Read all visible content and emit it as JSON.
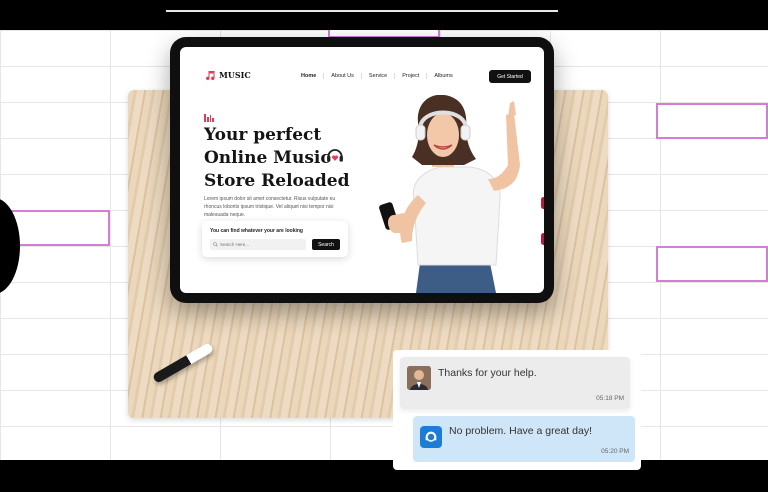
{
  "website": {
    "logo_text": "MUSIC",
    "nav": [
      "Home",
      "About Us",
      "Service",
      "Project",
      "Albums"
    ],
    "cta_label": "Get Started",
    "hero_title": "Your perfect Online Music Store Reloaded",
    "hero_description": "Lorem ipsum dolor sit amet consectetur. Risus vulputate eu rhoncus lobortis ipsum tristique. Vel aliquet nisi tempor nisi malesuada neque.",
    "search_label": "You can find whatever your are looking",
    "search_placeholder": "Search Here...",
    "search_button": "Search"
  },
  "chat": {
    "messages": [
      {
        "text": "Thanks for your help.",
        "time": "05:18 PM"
      },
      {
        "text": "No problem. Have a great day!",
        "time": "05:20 PM"
      }
    ]
  },
  "colors": {
    "accent": "#e53b5a",
    "highlight_border": "#d27fd3",
    "chat_reply_bg": "#cfe6f8",
    "agent_avatar": "#1c7cd6"
  }
}
